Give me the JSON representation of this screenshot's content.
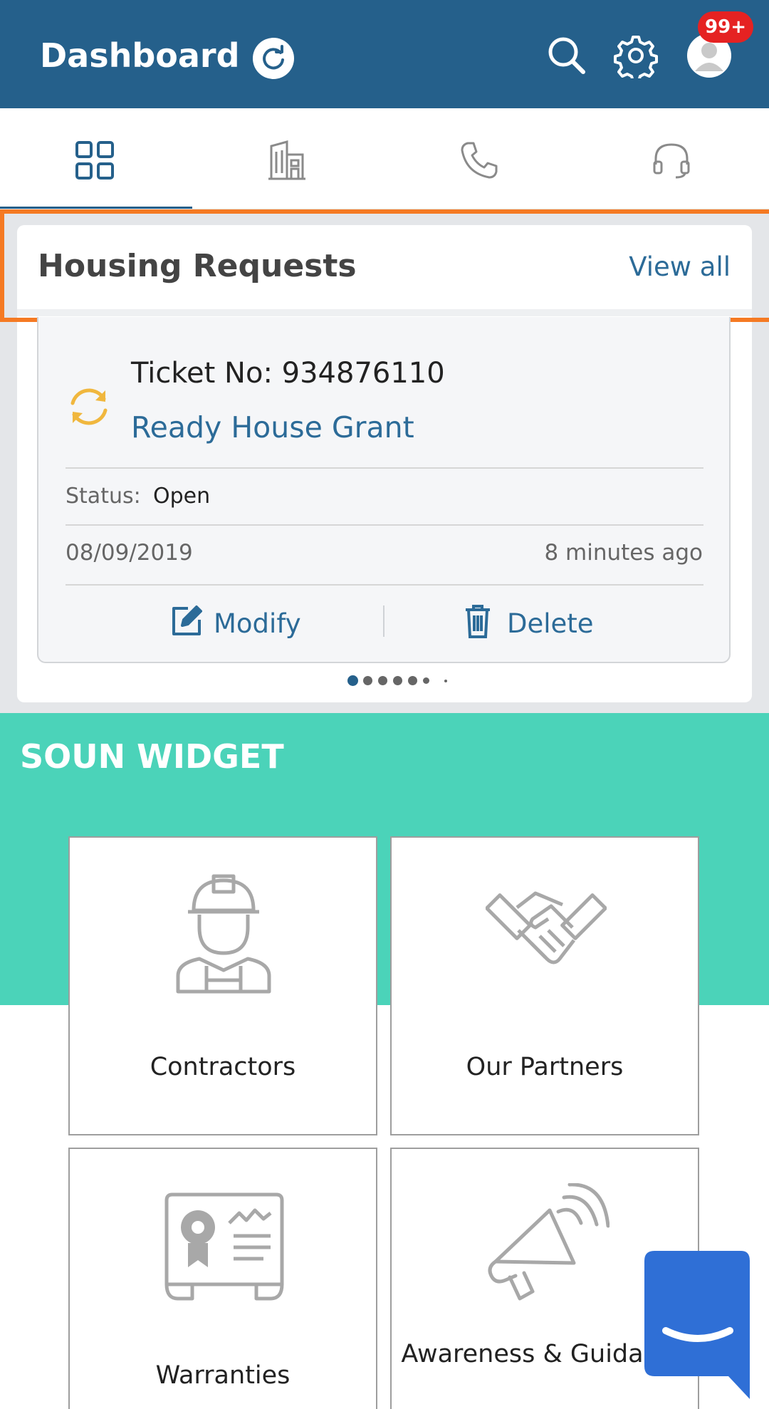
{
  "header": {
    "title": "Dashboard",
    "notification_badge": "99+"
  },
  "tabs": [
    {
      "name": "tab-dashboard",
      "icon": "grid-icon",
      "active": true
    },
    {
      "name": "tab-buildings",
      "icon": "building-icon",
      "active": false
    },
    {
      "name": "tab-phone",
      "icon": "phone-icon",
      "active": false
    },
    {
      "name": "tab-support",
      "icon": "headset-icon",
      "active": false
    }
  ],
  "housing_requests": {
    "title": "Housing Requests",
    "view_all": "View all",
    "ticket": {
      "ticket_no": "Ticket No: 934876110",
      "type": "Ready House Grant",
      "status_label": "Status:",
      "status_value": "Open",
      "date": "08/09/2019",
      "time_ago": "8 minutes ago",
      "modify_label": "Modify",
      "delete_label": "Delete"
    },
    "pagination": {
      "active_index": 0
    }
  },
  "widget": {
    "title": "SOUN WIDGET",
    "tiles": [
      {
        "label": "Contractors",
        "icon": "worker-helmet-icon"
      },
      {
        "label": "Our Partners",
        "icon": "handshake-icon"
      },
      {
        "label": "Warranties",
        "icon": "certificate-icon"
      },
      {
        "label": "Awareness & Guidance",
        "icon": "megaphone-icon"
      }
    ]
  },
  "colors": {
    "primary": "#25608b",
    "accent_link": "#2c6b98",
    "widget_bg": "#4bd3b9",
    "highlight": "#f57a23",
    "badge": "#e52222",
    "fab": "#2f6fd6"
  }
}
